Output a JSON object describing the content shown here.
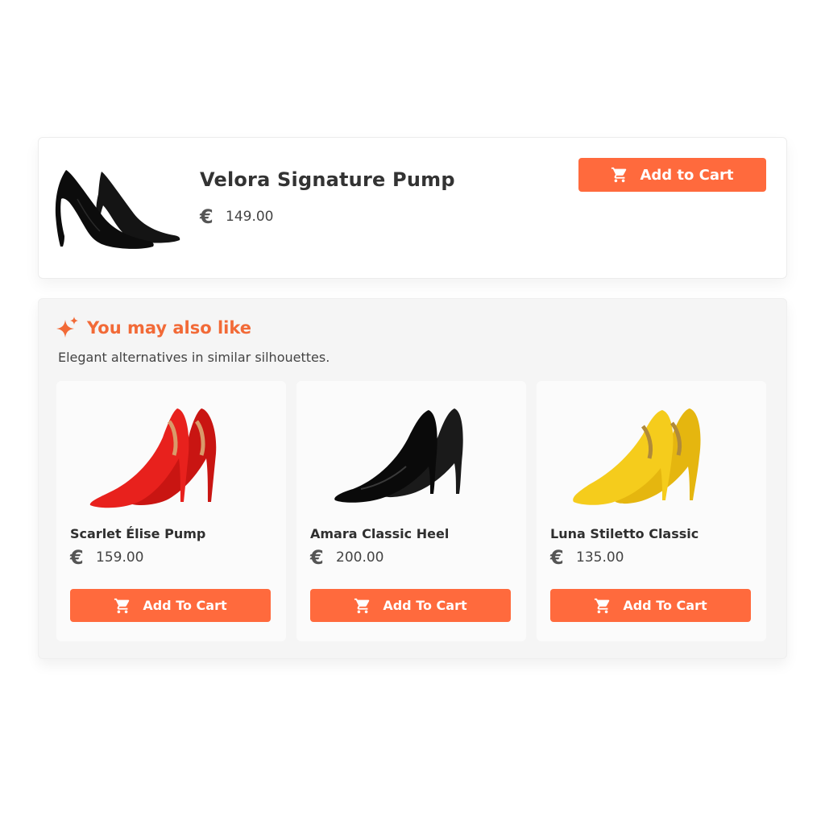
{
  "main_product": {
    "name": "Velora Signature Pump",
    "currency_symbol": "€",
    "price": "149.00",
    "add_to_cart_label": "Add to Cart",
    "shoe_color": "#111111"
  },
  "recommendations": {
    "title": "You may also like",
    "subtitle": "Elegant alternatives in similar silhouettes.",
    "icon": "sparkle-icon",
    "items": [
      {
        "name": "Scarlet Élise Pump",
        "currency_symbol": "€",
        "price": "159.00",
        "button_label": "Add To Cart",
        "shoe_color": "#e0201c"
      },
      {
        "name": "Amara Classic Heel",
        "currency_symbol": "€",
        "price": "200.00",
        "button_label": "Add To Cart",
        "shoe_color": "#111111"
      },
      {
        "name": "Luna Stiletto Classic",
        "currency_symbol": "€",
        "price": "135.00",
        "button_label": "Add To Cart",
        "shoe_color": "#f2c516"
      }
    ]
  },
  "colors": {
    "accent": "#ff6a3d",
    "title_accent": "#f26a37",
    "panel_bg": "#f5f5f5"
  }
}
